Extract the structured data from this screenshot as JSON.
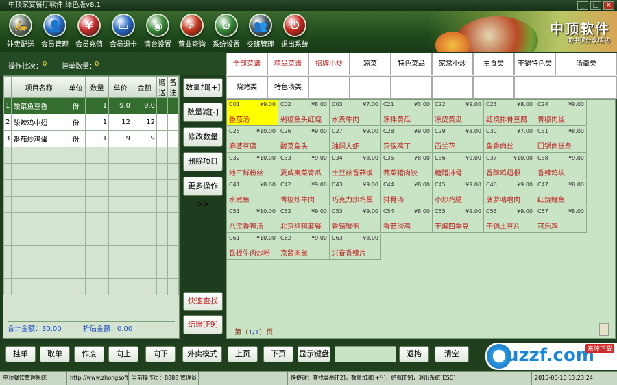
{
  "window": {
    "title": "中顶家宴餐厅软件 绿色版v8.1",
    "min": "_",
    "max": "□",
    "close": "×"
  },
  "toolbar": [
    {
      "label": "外卖配送",
      "icon": "bike-icon",
      "glyph": "🛵",
      "color": "#6a7a6a"
    },
    {
      "label": "会员管理",
      "icon": "user-icon",
      "glyph": "👤",
      "color": "#2a6ac8"
    },
    {
      "label": "会员充值",
      "icon": "card-icon",
      "glyph": "¥",
      "color": "#c83030"
    },
    {
      "label": "会员退卡",
      "icon": "card-return-icon",
      "glyph": "▭",
      "color": "#2a6ac8"
    },
    {
      "label": "清台设置",
      "icon": "plate-icon",
      "glyph": "◉",
      "color": "#3a8a3a"
    },
    {
      "label": "营业查询",
      "icon": "search-icon",
      "glyph": "⌕",
      "color": "#c83a20"
    },
    {
      "label": "系统设置",
      "icon": "gear-icon",
      "glyph": "⚙",
      "color": "#3a8a3a"
    },
    {
      "label": "交班管理",
      "icon": "group-icon",
      "glyph": "👥",
      "color": "#4a5a6a"
    },
    {
      "label": "退出系统",
      "icon": "power-icon",
      "glyph": "⏻",
      "color": "#c82a20"
    }
  ],
  "brand": {
    "title": "中顶软件",
    "slogan": "助中顶分享成功"
  },
  "info": {
    "batch_label": "操作批次：",
    "batch_value": "0",
    "dish_count_label": "挂单数量：",
    "dish_count_value": "0"
  },
  "order_table": {
    "headers": [
      "",
      "项目名称",
      "单位",
      "数量",
      "单价",
      "金额",
      "赠送",
      "备注"
    ],
    "rows": [
      {
        "no": "1",
        "name": "酸菜鱼豆香",
        "unit": "份",
        "qty": "1",
        "price": "9.0",
        "amount": "9.0",
        "gift": "",
        "note": ""
      },
      {
        "no": "2",
        "name": "酸辣鸡中翅",
        "unit": "份",
        "qty": "1",
        "price": "12",
        "amount": "12",
        "gift": "",
        "note": ""
      },
      {
        "no": "3",
        "name": "番茄炒鸡蛋",
        "unit": "份",
        "qty": "1",
        "price": "9",
        "amount": "9",
        "gift": "",
        "note": ""
      }
    ],
    "total_label": "合计金额：",
    "total_value": "30.00",
    "discount_label": "折后金额：",
    "discount_value": "0.00"
  },
  "middle_buttons": [
    {
      "label": "数量加[+]",
      "red": false,
      "name": "qty-plus-button"
    },
    {
      "label": "数量减[-]",
      "red": false,
      "name": "qty-minus-button"
    },
    {
      "label": "修改数量",
      "red": false,
      "name": "edit-qty-button"
    },
    {
      "label": "删除项目",
      "red": false,
      "name": "delete-item-button"
    },
    {
      "label": "更多操作>>",
      "red": false,
      "name": "more-ops-button"
    },
    {
      "label": "快速查找",
      "red": true,
      "name": "quick-find-button"
    },
    {
      "label": "结账[F9]",
      "red": true,
      "name": "checkout-button"
    }
  ],
  "categories_row1": [
    {
      "label": "全部菜谱",
      "red": true
    },
    {
      "label": "精品菜谱",
      "red": true
    },
    {
      "label": "招牌小炒",
      "red": true
    },
    {
      "label": "凉菜",
      "red": false
    },
    {
      "label": "特色菜品",
      "red": false
    },
    {
      "label": "家常小炒",
      "red": false
    },
    {
      "label": "主食类",
      "red": false
    },
    {
      "label": "干锅特色类",
      "red": false
    },
    {
      "label": "汤羹类",
      "red": false
    }
  ],
  "categories_row2": [
    {
      "label": "烧烤类",
      "red": false
    },
    {
      "label": "特色汤类",
      "red": false
    },
    {
      "label": "",
      "red": false
    },
    {
      "label": "",
      "red": false
    },
    {
      "label": "",
      "red": false
    },
    {
      "label": "",
      "red": false
    },
    {
      "label": "",
      "red": false
    },
    {
      "label": "",
      "red": false
    }
  ],
  "dishes": [
    {
      "code": "C01",
      "price": "¥9.00",
      "name": "番茄汤",
      "selected": true
    },
    {
      "code": "C02",
      "price": "¥8.00",
      "name": "剁椒鱼头红烧",
      "selected": false
    },
    {
      "code": "C03",
      "price": "¥7.00",
      "name": "水煮牛肉",
      "selected": false
    },
    {
      "code": "C21",
      "price": "¥3.00",
      "name": "凉拌黄瓜",
      "selected": false
    },
    {
      "code": "C22",
      "price": "¥9.00",
      "name": "凉皮黄瓜",
      "selected": false
    },
    {
      "code": "C23",
      "price": "¥8.00",
      "name": "红烧排骨豆腐",
      "selected": false
    },
    {
      "code": "C24",
      "price": "¥9.00",
      "name": "青椒肉丝",
      "selected": false
    },
    {
      "code": "C25",
      "price": "¥10.00",
      "name": "麻婆豆腐",
      "selected": false
    },
    {
      "code": "C26",
      "price": "¥9.00",
      "name": "酸菜鱼头",
      "selected": false
    },
    {
      "code": "C27",
      "price": "¥9.00",
      "name": "油焖大虾",
      "selected": false
    },
    {
      "code": "C28",
      "price": "¥9.00",
      "name": "宫保鸡丁",
      "selected": false
    },
    {
      "code": "C29",
      "price": "¥8.00",
      "name": "西兰花",
      "selected": false
    },
    {
      "code": "C30",
      "price": "¥7.00",
      "name": "鱼香肉丝",
      "selected": false
    },
    {
      "code": "C31",
      "price": "¥8.00",
      "name": "回锅肉丝条",
      "selected": false
    },
    {
      "code": "C32",
      "price": "¥10.00",
      "name": "地三鲜粉丝",
      "selected": false
    },
    {
      "code": "C33",
      "price": "¥9.00",
      "name": "夏威夷菜青瓜",
      "selected": false
    },
    {
      "code": "C34",
      "price": "¥8.00",
      "name": "土豆丝香菇饭",
      "selected": false
    },
    {
      "code": "C35",
      "price": "¥8.00",
      "name": "荠菜猪肉饺",
      "selected": false
    },
    {
      "code": "C36",
      "price": "¥9.00",
      "name": "糖醋排骨",
      "selected": false
    },
    {
      "code": "C37",
      "price": "¥10.00",
      "name": "香酥鸡翅根",
      "selected": false
    },
    {
      "code": "C38",
      "price": "¥9.00",
      "name": "香辣鸡块",
      "selected": false
    },
    {
      "code": "C41",
      "price": "¥8.00",
      "name": "水煮鱼",
      "selected": false
    },
    {
      "code": "C42",
      "price": "¥9.00",
      "name": "青椒炒牛肉",
      "selected": false
    },
    {
      "code": "C43",
      "price": "¥9.00",
      "name": "巧克力炒鸡蛋",
      "selected": false
    },
    {
      "code": "C44",
      "price": "¥8.00",
      "name": "排骨汤",
      "selected": false
    },
    {
      "code": "C45",
      "price": "¥9.00",
      "name": "小炒鸡腿",
      "selected": false
    },
    {
      "code": "C46",
      "price": "¥9.00",
      "name": "菠萝咕噜肉",
      "selected": false
    },
    {
      "code": "C47",
      "price": "¥8.00",
      "name": "红烧鲤鱼",
      "selected": false
    },
    {
      "code": "C51",
      "price": "¥10.00",
      "name": "八宝香鸭汤",
      "selected": false
    },
    {
      "code": "C52",
      "price": "¥9.00",
      "name": "北京烤鸭套餐",
      "selected": false
    },
    {
      "code": "C53",
      "price": "¥9.00",
      "name": "香辣蟹粥",
      "selected": false
    },
    {
      "code": "C54",
      "price": "¥8.00",
      "name": "香菇滑鸡",
      "selected": false
    },
    {
      "code": "C55",
      "price": "¥9.00",
      "name": "干煸四季豆",
      "selected": false
    },
    {
      "code": "C56",
      "price": "¥9.00",
      "name": "干锅土豆片",
      "selected": false
    },
    {
      "code": "C57",
      "price": "¥8.00",
      "name": "可乐鸡",
      "selected": false
    },
    {
      "code": "C61",
      "price": "¥10.00",
      "name": "铁板牛肉炒粉",
      "selected": false
    },
    {
      "code": "C62",
      "price": "¥9.00",
      "name": "京酱肉丝",
      "selected": false
    },
    {
      "code": "C63",
      "price": "¥8.00",
      "name": "兴奋香辣片",
      "selected": false
    }
  ],
  "page_indicator": {
    "prefix": "第（",
    "current": "1/1",
    "suffix": "）页"
  },
  "bottom_buttons": [
    "挂单",
    "取单",
    "作废",
    "向上",
    "向下",
    "外卖模式",
    "上页",
    "下页",
    "显示键盘",
    "退格",
    "清空"
  ],
  "bottom_logo": {
    "text": "uzzf.com",
    "sub": "东坡下载"
  },
  "status": {
    "s1": "中顶餐饮管理系统",
    "s2": "http://www.zhongsoft.com",
    "s3": "当前操作员：8888 管理员",
    "s4": "快捷键：查找菜品[F2]，数量加减[+/-]，结账[F9]，退出系统[ESC]",
    "s5": "2015-06-16 13:23:24"
  }
}
